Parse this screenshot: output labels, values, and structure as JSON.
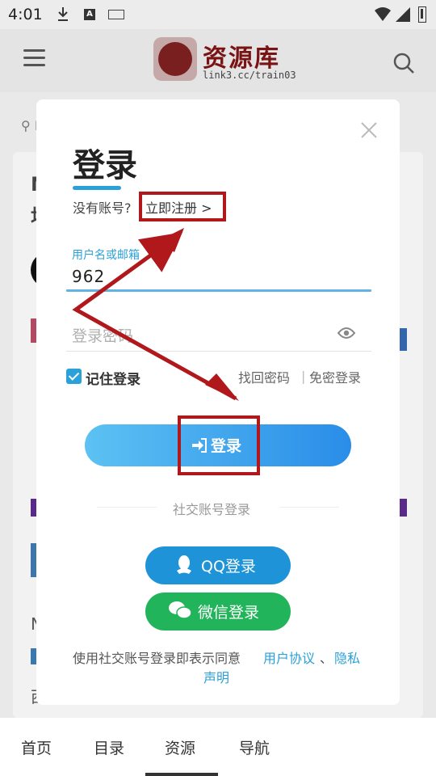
{
  "status_bar": {
    "time": "4:01",
    "a_icon": "A"
  },
  "site": {
    "logo_text": "资源库",
    "logo_url": "link3.cc/train03"
  },
  "background": {
    "loc_prefix": "I",
    "n1": "N",
    "n2": "均",
    "n3": "N",
    "n5": "西"
  },
  "modal": {
    "title": "登录",
    "no_account": "没有账号?",
    "register": "立即注册 >",
    "username_label": "用户名或邮箱",
    "username_value": "962",
    "password_placeholder": "登录密码",
    "remember": "记住登录",
    "forgot": "找回密码",
    "sep": "|",
    "passwordless": "免密登录",
    "login_button": "登录",
    "social_label": "社交账号登录",
    "qq_login": "QQ登录",
    "wechat_login": "微信登录",
    "agree_text": "使用社交账号登录即表示同意",
    "user_agreement": "用户协议",
    "dot": "、",
    "privacy_1": "隐私",
    "privacy_2": "声明"
  },
  "bottom_nav": {
    "items": [
      "首页",
      "目录",
      "资源",
      "导航"
    ],
    "active": "资源"
  },
  "colors": {
    "accent": "#2aa1d8",
    "annotation": "#b1181b",
    "qq": "#1f93d8",
    "wechat": "#22b45a"
  }
}
